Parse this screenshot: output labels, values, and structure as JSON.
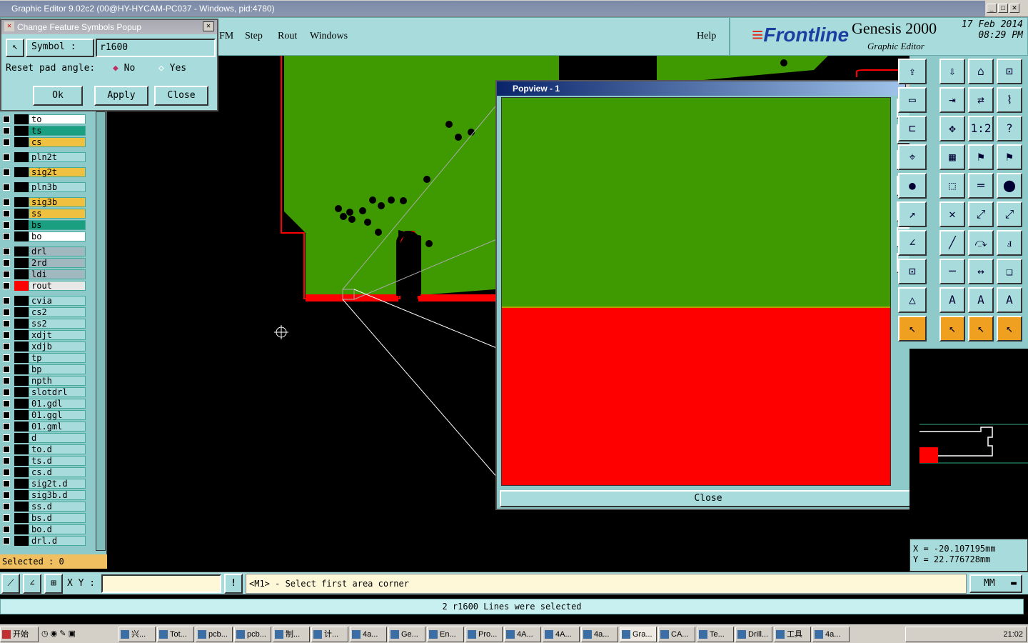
{
  "window": {
    "title": "Graphic Editor 9.02c2 (00@HY-HYCAM-PC037 - Windows, pid:4780)"
  },
  "menu": {
    "items": [
      "FM",
      "Step",
      "Rout",
      "Windows"
    ],
    "help": "Help"
  },
  "brand": {
    "logo": "Frontline",
    "product": "Genesis 2000",
    "subtitle": "Graphic Editor",
    "date": "17 Feb 2014",
    "time": "08:29 PM"
  },
  "popup": {
    "title": "Change Feature Symbols Popup",
    "symbol_label": "Symbol :",
    "symbol_value": "r1600",
    "reset_label": "Reset pad angle:",
    "opt_no": "No",
    "opt_yes": "Yes",
    "ok": "Ok",
    "apply": "Apply",
    "close": "Close"
  },
  "layers": [
    {
      "name": "to",
      "color": "#ffffff"
    },
    {
      "name": "ts",
      "color": "#1aa080"
    },
    {
      "name": "cs",
      "color": "#f0c040"
    },
    {
      "name": "pln2t",
      "color": "#a8dcdc"
    },
    {
      "name": "sig2t",
      "color": "#f0c040"
    },
    {
      "name": "pln3b",
      "color": "#a8dcdc"
    },
    {
      "name": "sig3b",
      "color": "#f0c040"
    },
    {
      "name": "ss",
      "color": "#f0c040"
    },
    {
      "name": "bs",
      "color": "#1aa080"
    },
    {
      "name": "bo",
      "color": "#ffffff"
    },
    {
      "name": "drl",
      "color": "#a0b8c0"
    },
    {
      "name": "2rd",
      "color": "#a0b8c0"
    },
    {
      "name": "ldi",
      "color": "#a0b8c0"
    },
    {
      "name": "rout",
      "color": "#e8e8e8"
    },
    {
      "name": "cvia",
      "color": "#a8dcdc"
    },
    {
      "name": "cs2",
      "color": "#a8dcdc"
    },
    {
      "name": "ss2",
      "color": "#a8dcdc"
    },
    {
      "name": "xdjt",
      "color": "#a8dcdc"
    },
    {
      "name": "xdjb",
      "color": "#a8dcdc"
    },
    {
      "name": "tp",
      "color": "#a8dcdc"
    },
    {
      "name": "bp",
      "color": "#a8dcdc"
    },
    {
      "name": "npth",
      "color": "#a8dcdc"
    },
    {
      "name": "slotdrl",
      "color": "#a8dcdc"
    },
    {
      "name": "01.gdl",
      "color": "#a8dcdc"
    },
    {
      "name": "01.ggl",
      "color": "#a8dcdc"
    },
    {
      "name": "01.gml",
      "color": "#a8dcdc"
    },
    {
      "name": "d",
      "color": "#a8dcdc"
    },
    {
      "name": "to.d",
      "color": "#a8dcdc"
    },
    {
      "name": "ts.d",
      "color": "#a8dcdc"
    },
    {
      "name": "cs.d",
      "color": "#a8dcdc"
    },
    {
      "name": "sig2t.d",
      "color": "#a8dcdc"
    },
    {
      "name": "sig3b.d",
      "color": "#a8dcdc"
    },
    {
      "name": "ss.d",
      "color": "#a8dcdc"
    },
    {
      "name": "bs.d",
      "color": "#a8dcdc"
    },
    {
      "name": "bo.d",
      "color": "#a8dcdc"
    },
    {
      "name": "drl.d",
      "color": "#a8dcdc"
    }
  ],
  "selected": "Selected : 0",
  "popview": {
    "title": "Popview - 1",
    "close": "Close"
  },
  "coords": {
    "x": "X = -20.107195mm",
    "y": "Y = 22.776728mm"
  },
  "cmd": {
    "xy_label": "X Y :",
    "prompt": "<M1> - Select first area corner",
    "units": "MM"
  },
  "status": "2 r1600 Lines were selected",
  "taskbar": {
    "start": "开始",
    "tasks": [
      "兴...",
      "Tot...",
      "pcb...",
      "pcb...",
      "制...",
      "计...",
      "4a...",
      "Ge...",
      "En...",
      "Pro...",
      "4A...",
      "4A...",
      "4a...",
      "Gra...",
      "CA...",
      "Te...",
      "Drill...",
      "工具",
      "4a..."
    ],
    "clock": "21:02"
  },
  "colors": {
    "board_green": "#3e9a00",
    "rout_red": "#ff0000",
    "ui_cyan": "#a8dcdc"
  }
}
